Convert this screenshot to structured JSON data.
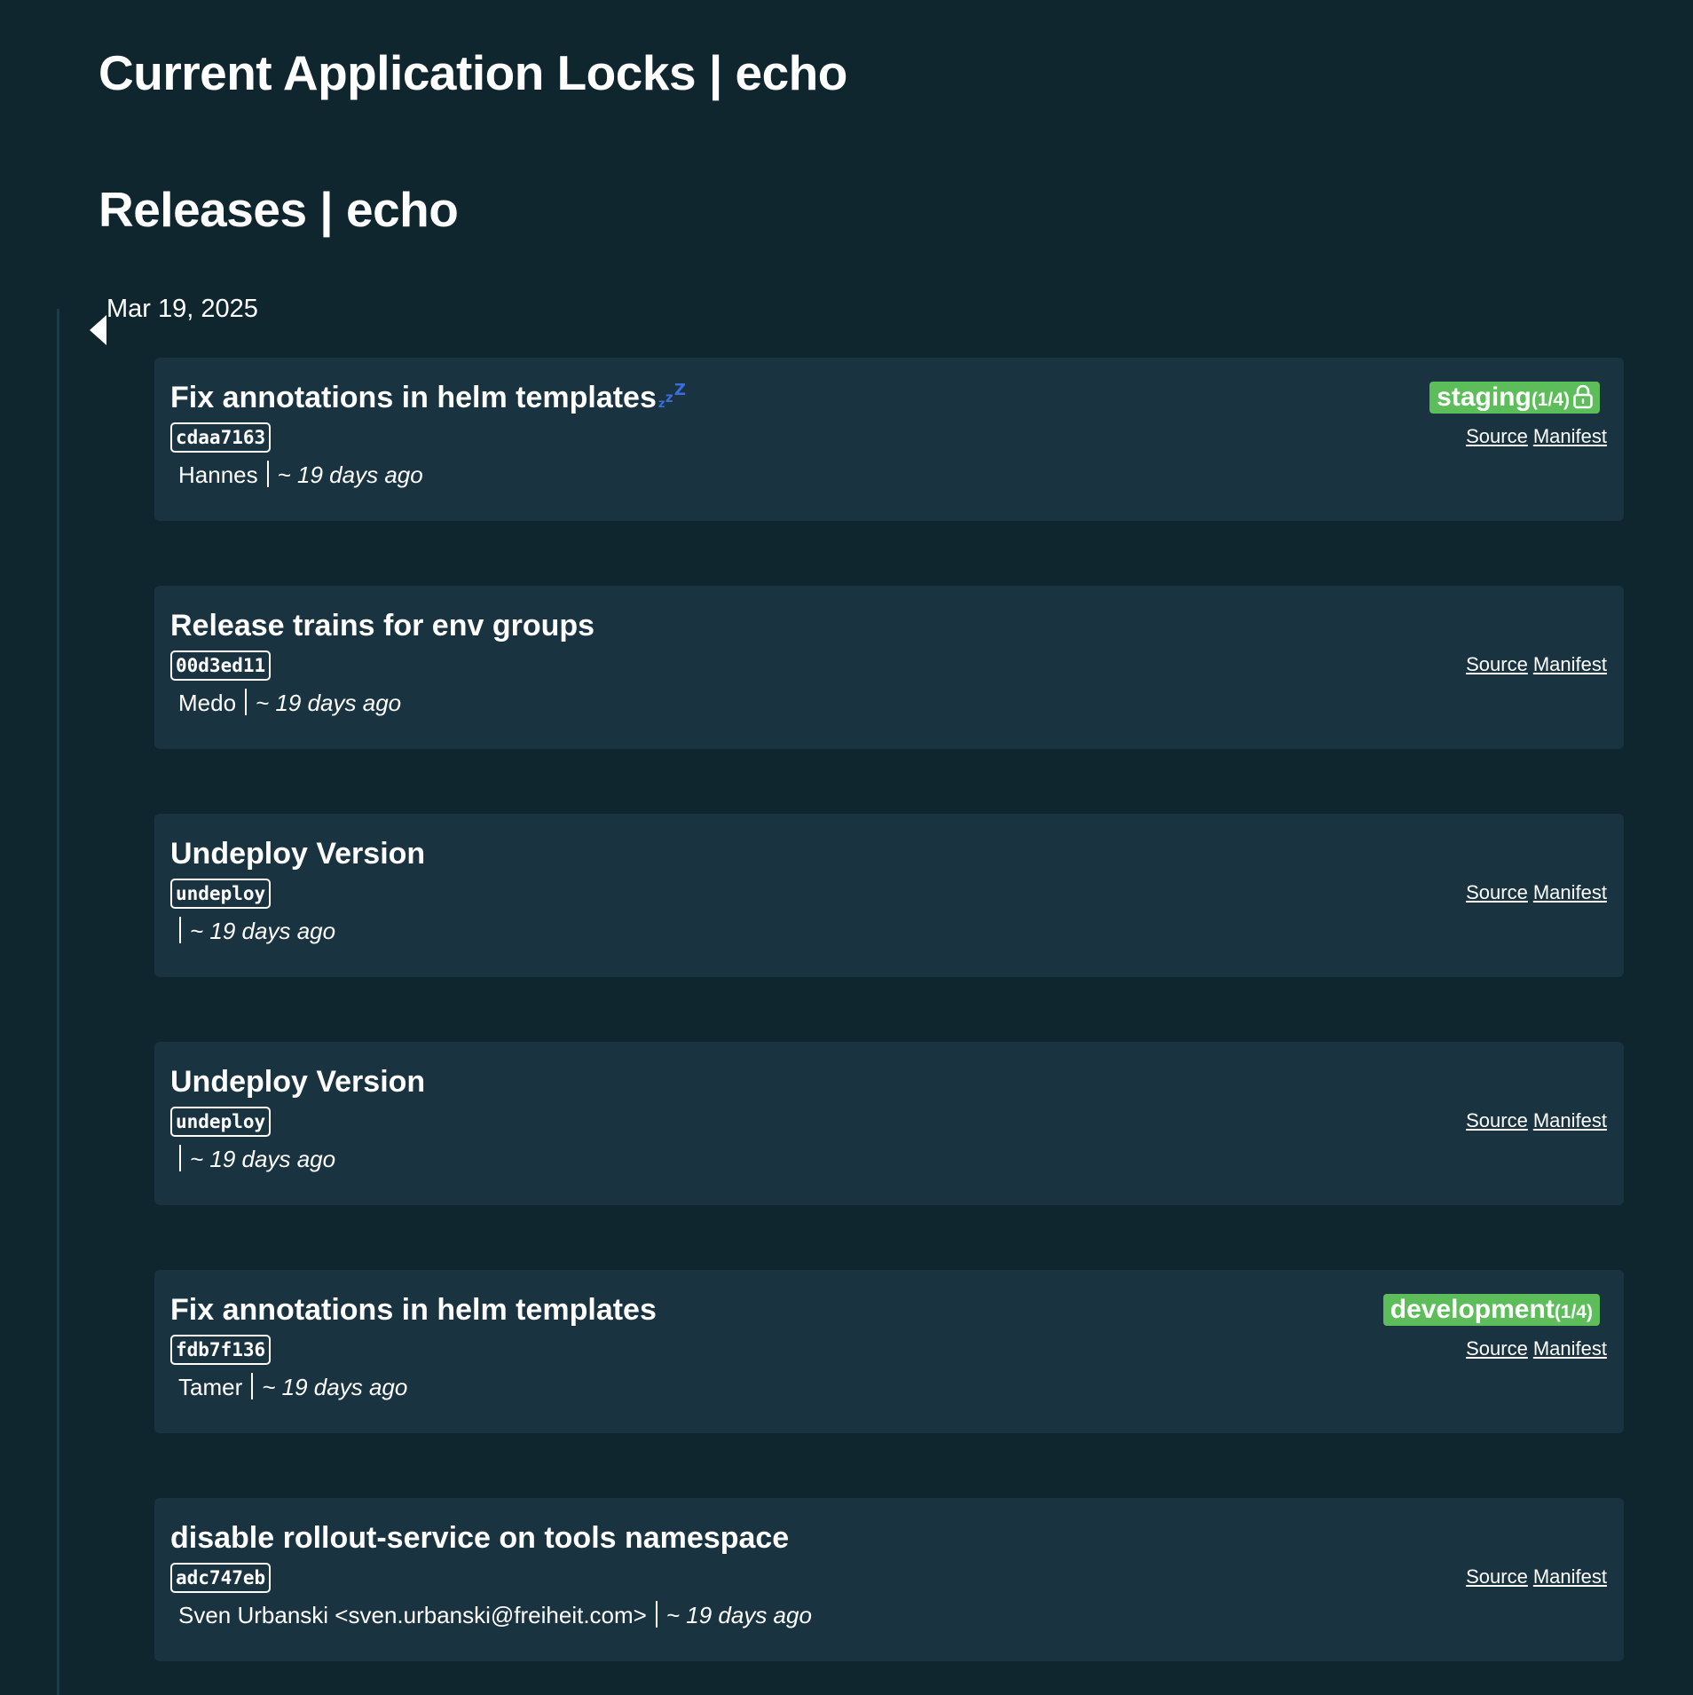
{
  "locks_heading": "Current Application Locks | echo",
  "releases_heading": "Releases | echo",
  "date_label": "Mar 19, 2025",
  "colors": {
    "background": "#10262f",
    "card": "#193440",
    "env_tag": "#5ebd5b",
    "sleep_icon": "#3b6de0"
  },
  "releases": [
    {
      "title": "Fix annotations in helm templates",
      "commit": "cdaa7163",
      "author": "Hannes",
      "time": "~ 19 days ago",
      "env": {
        "name": "staging",
        "count": "(1/4)",
        "locked": true
      },
      "sleep_icon": "zz-sleep-icon",
      "source_label": "Source",
      "manifest_label": "Manifest"
    },
    {
      "title": "Release trains for env groups",
      "commit": "00d3ed11",
      "author": "Medo",
      "time": "~ 19 days ago",
      "source_label": "Source",
      "manifest_label": "Manifest"
    },
    {
      "title": "Undeploy Version",
      "commit": "undeploy",
      "author": "",
      "time": "~ 19 days ago",
      "source_label": "Source",
      "manifest_label": "Manifest"
    },
    {
      "title": "Undeploy Version",
      "commit": "undeploy",
      "author": "",
      "time": "~ 19 days ago",
      "source_label": "Source",
      "manifest_label": "Manifest"
    },
    {
      "title": "Fix annotations in helm templates",
      "commit": "fdb7f136",
      "author": "Tamer",
      "time": "~ 19 days ago",
      "env": {
        "name": "development",
        "count": "(1/4)",
        "locked": false
      },
      "source_label": "Source",
      "manifest_label": "Manifest"
    },
    {
      "title": "disable rollout-service on tools namespace",
      "commit": "adc747eb",
      "author": "Sven Urbanski <sven.urbanski@freiheit.com>",
      "time": "~ 19 days ago",
      "source_label": "Source",
      "manifest_label": "Manifest"
    }
  ]
}
